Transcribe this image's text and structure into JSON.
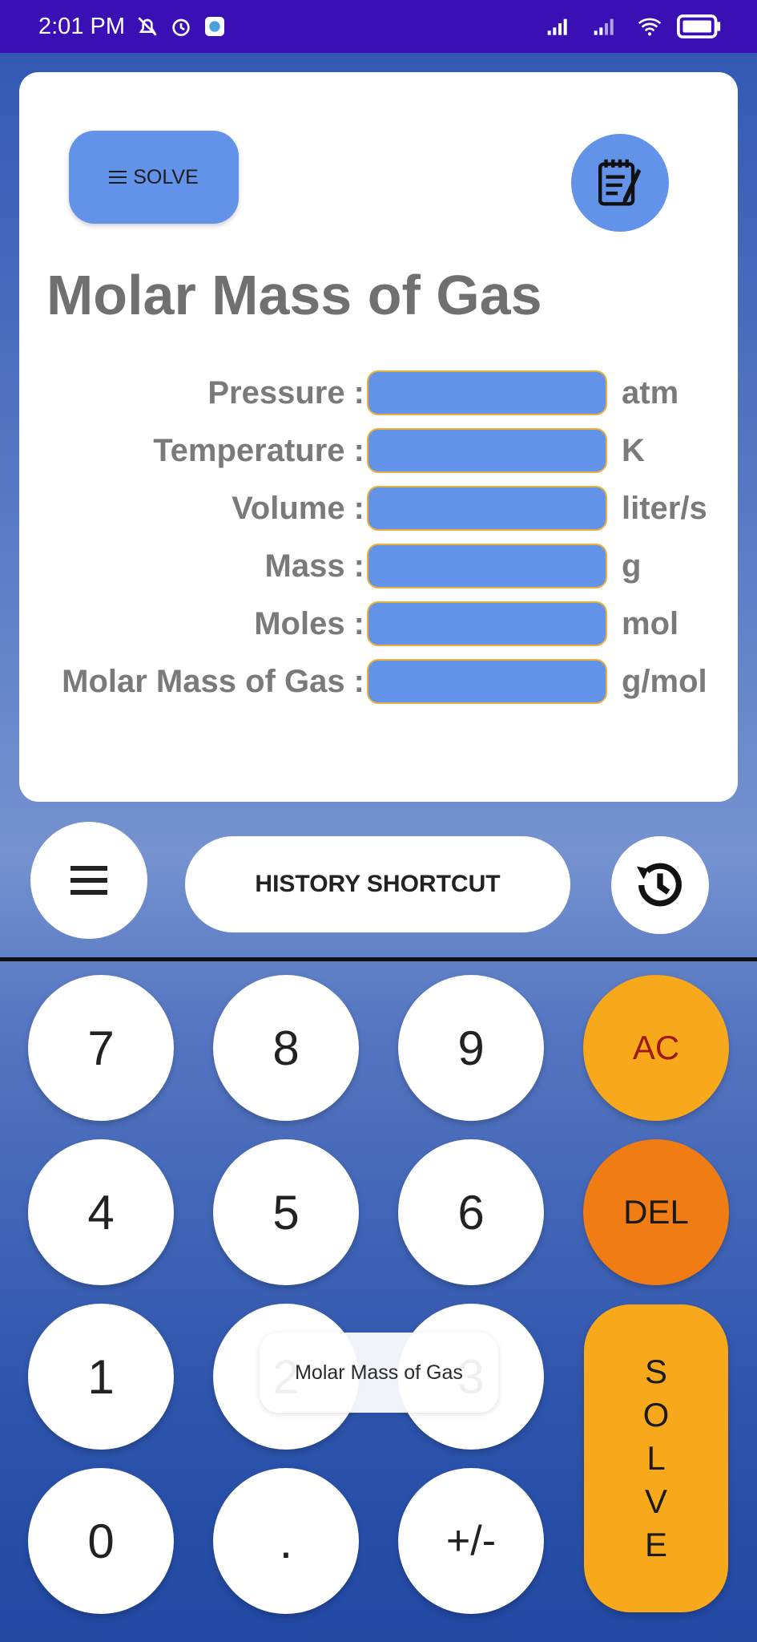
{
  "status_bar": {
    "time": "2:01 PM",
    "left_icons": [
      "mute-icon",
      "alarm-icon",
      "app-notification-icon"
    ],
    "right_icons": [
      "signal-icon",
      "signal-icon",
      "wifi-icon",
      "battery-icon"
    ]
  },
  "card": {
    "solve_label": "SOLVE",
    "title": "Molar Mass of Gas",
    "fields": [
      {
        "label": "Pressure :",
        "unit": "atm",
        "value": ""
      },
      {
        "label": "Temperature :",
        "unit": "K",
        "value": ""
      },
      {
        "label": "Volume :",
        "unit": "liter/s",
        "value": ""
      },
      {
        "label": "Mass :",
        "unit": "g",
        "value": ""
      },
      {
        "label": "Moles :",
        "unit": "mol",
        "value": ""
      },
      {
        "label": "Molar Mass of Gas :",
        "unit": "g/mol",
        "value": ""
      }
    ]
  },
  "toolbar": {
    "history_label": "HISTORY SHORTCUT"
  },
  "keypad": {
    "keys": [
      "7",
      "8",
      "9",
      "AC",
      "4",
      "5",
      "6",
      "DEL",
      "1",
      "2",
      "3",
      "0",
      ".",
      "+/-"
    ],
    "solve_letters": [
      "S",
      "O",
      "L",
      "V",
      "E"
    ]
  },
  "toast": "Molar Mass of Gas",
  "colors": {
    "status_bar": "#3a10b5",
    "accent_blue": "#6393e8",
    "ac_key": "#f7a81b",
    "del_key": "#f07c14",
    "input_border": "#e8b13a"
  }
}
